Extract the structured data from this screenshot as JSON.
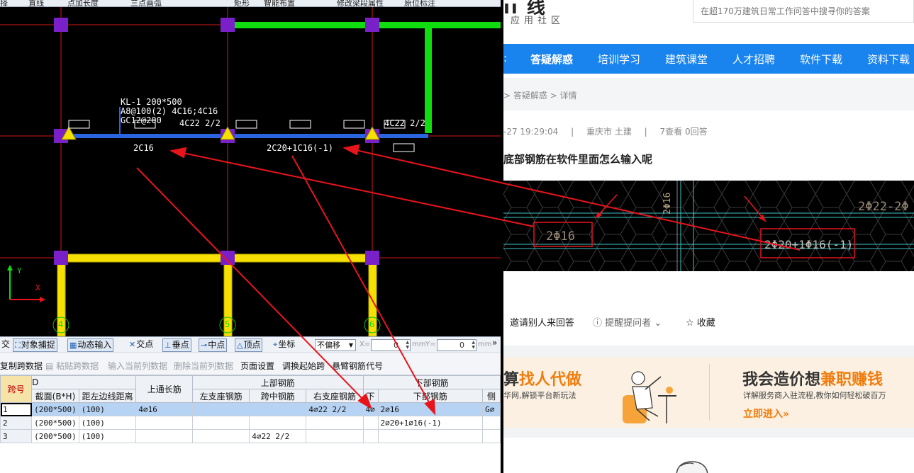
{
  "cad": {
    "toolbar": {
      "items": [
        "择",
        "直线",
        "点加长度",
        "三点画弧",
        "矩形",
        "智能布置",
        "修改梁段属性",
        "原位标注"
      ]
    },
    "canvas": {
      "beam_label_line1": "KL-1 200*500",
      "beam_label_line2": "A8@100(2) 4C16;4C16",
      "beam_label_line3": "GC12@200",
      "top_mid_span": "4C22 2/2",
      "top_right_support": "4C22 2/2",
      "bottom_span1": "2C16",
      "bottom_span2": "2C20+1C16(-1)",
      "axis_numbers": [
        "4",
        "5",
        "6"
      ],
      "ucs_x": "X",
      "ucs_y": "Y"
    },
    "snapbar": {
      "jiao": "交",
      "object_snap": "对象捕捉",
      "dynamic_input": "动态输入",
      "intersection": "交点",
      "perpendicular": "垂点",
      "midpoint": "中点",
      "vertex": "顶点",
      "coordinate": "坐标",
      "offset_mode": "不偏移",
      "x_label": "X=",
      "x_value": "0",
      "y_label": "Y=",
      "y_value": "0",
      "unit": "mm",
      "more": "»"
    },
    "gridbar": {
      "copy_span": "复制跨数据",
      "paste_span": "粘贴跨数据",
      "input_col": "输入当前列数据",
      "delete_col": "删除当前列数据",
      "page_setup": "页面设置",
      "swap_start": "调换起始跨",
      "cantilever": "悬臂钢筋代号"
    },
    "table": {
      "headers": {
        "span_no": "跨号",
        "group_d": "D",
        "section": "截面(B*H)",
        "edge_dist": "距左边线距离",
        "top_through": "上通长筋",
        "top_group": "上部钢筋",
        "top_left": "左支座钢筋",
        "top_mid": "跨中钢筋",
        "top_right": "右支座钢筋",
        "bottom_group": "下部钢筋",
        "bottom_lower": "下",
        "bottom_rebar": "下部钢筋",
        "side": "侧"
      },
      "rows": [
        {
          "no": "1",
          "section": "(200*500)",
          "edge": "(100)",
          "through": "4⌀16",
          "left": "",
          "mid": "",
          "right": "4⌀22 2/2",
          "lower": "4⌀",
          "bottom": "2⌀16",
          "side": "G⌀"
        },
        {
          "no": "2",
          "section": "(200*500)",
          "edge": "(100)",
          "through": "",
          "left": "",
          "mid": "",
          "right": "",
          "lower": "",
          "bottom": "2⌀20+1⌀16(-1)",
          "side": ""
        },
        {
          "no": "3",
          "section": "(200*500)",
          "edge": "(100)",
          "through": "",
          "left": "",
          "mid": "4⌀22 2/2",
          "right": "",
          "lower": "",
          "bottom": "",
          "side": ""
        }
      ]
    }
  },
  "web": {
    "logo_text": "ıı 线",
    "logo_sub": "应用社区",
    "search_placeholder": "在超170万建筑日常工作问答中搜寻你的答案",
    "nav": [
      "答疑解惑",
      "培训学习",
      "建筑课堂",
      "人才招聘",
      "软件下载",
      "资料下载"
    ],
    "breadcrumb": "> 答疑解惑 > 详情",
    "meta_time": "-27 19:29:04",
    "meta_sep": "|",
    "meta_region": "重庆市 土建",
    "meta_views": "7查看 0回答",
    "question_title": "底部钢筋在软件里面怎么输入呢",
    "image_labels": {
      "vertical": "2Φ16",
      "left_box": "2Φ16",
      "right_box": "2Φ20+1Φ16(-1)",
      "top_right": "2Φ22-2Φ"
    },
    "actions": {
      "invite": "邀请别人来回答",
      "remind": "提醒提问者",
      "favorite": "收藏"
    },
    "banner": {
      "left_title_a": "算",
      "left_title_b": "找人代做",
      "left_sub": "华网,解锁平台新玩法",
      "right_title_a": "我会造价想",
      "right_title_b": "兼职赚钱",
      "right_sub": "详解服务商入驻流程,教你如何轻松破百万",
      "cta": "立即进入»"
    }
  },
  "colors": {
    "nav_blue": "#1a84ee",
    "annotation_red": "#e8141b",
    "cad_green": "#10dd10",
    "cad_yellow": "#f5e000",
    "cad_purple": "#7a20c8",
    "cad_blue_beam": "#2a64e0",
    "orange": "#f07d0e"
  }
}
